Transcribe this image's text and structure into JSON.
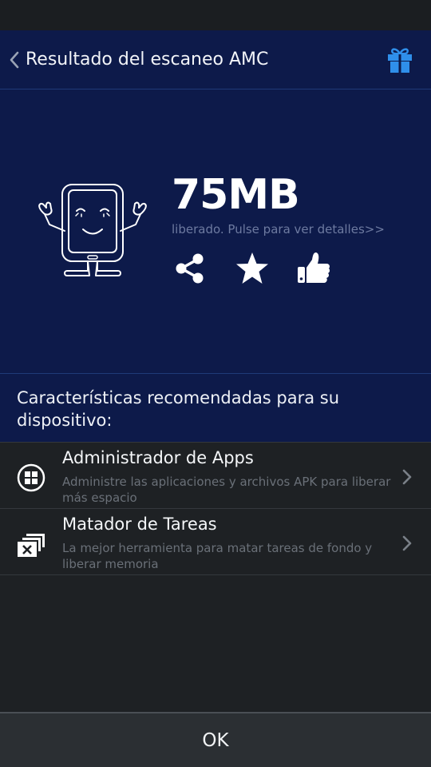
{
  "header": {
    "title": "Resultado del escaneo AMC",
    "back_icon": "chevron-left-icon",
    "gift_icon": "gift-icon"
  },
  "result": {
    "amount": "75MB",
    "detail": "liberado. Pulse para ver detalles>>",
    "actions": [
      "share-icon",
      "star-icon",
      "thumbs-up-icon"
    ]
  },
  "recommendations": {
    "title": "Características recomendadas para su dispositivo:",
    "items": [
      {
        "title": "Administrador de Apps",
        "description": "Administre las aplicaciones y archivos APK para liberar más espacio",
        "icon": "apps-grid-icon"
      },
      {
        "title": "Matador de Tareas",
        "description": "La mejor herramienta para matar tareas de fondo y liberar memoria",
        "icon": "task-killer-icon"
      }
    ]
  },
  "footer": {
    "ok_label": "OK"
  },
  "colors": {
    "header_bg": "#0d1a4a",
    "body_bg": "#1e2124",
    "accent_blue": "#2f8fea",
    "muted_text": "#6d7aa0"
  }
}
